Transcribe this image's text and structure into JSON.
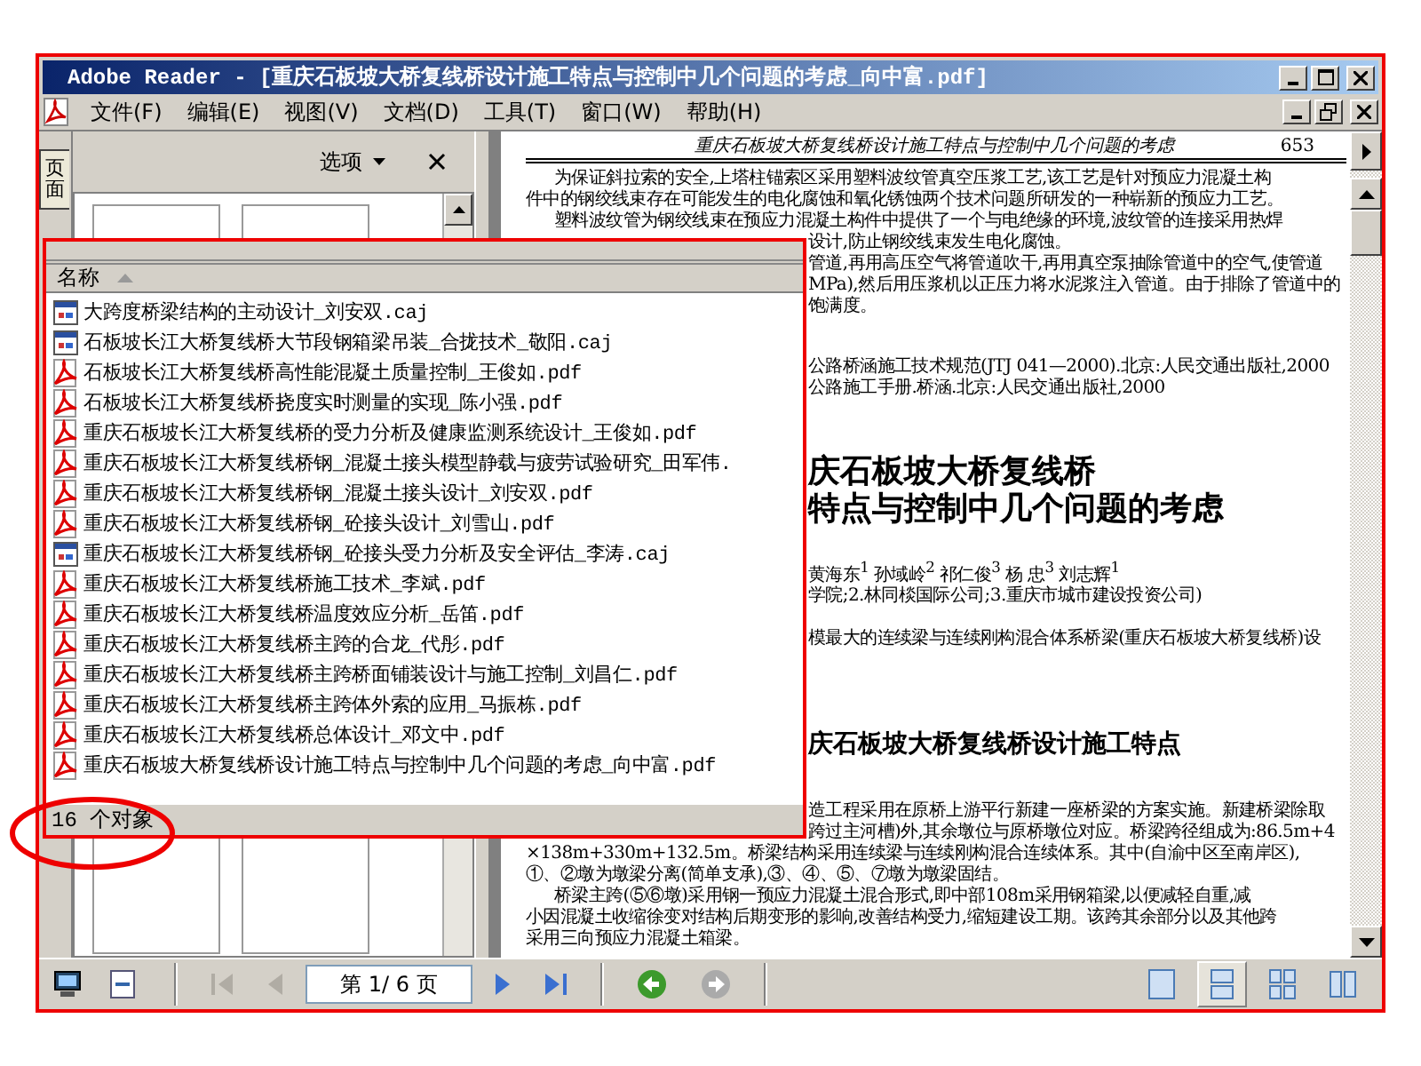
{
  "window": {
    "title": "Adobe Reader - [重庆石板坡大桥复线桥设计施工特点与控制中几个问题的考虑_向中富.pdf]"
  },
  "menu": [
    {
      "label": "文件(F)"
    },
    {
      "label": "编辑(E)"
    },
    {
      "label": "视图(V)"
    },
    {
      "label": "文档(D)"
    },
    {
      "label": "工具(T)"
    },
    {
      "label": "窗口(W)"
    },
    {
      "label": "帮助(H)"
    }
  ],
  "side_panel": {
    "tab": {
      "label": "页面",
      "selected": true
    },
    "options": "选项"
  },
  "document": {
    "running_title": "重庆石板坡大桥复线桥设计施工特点与控制中几个问题的考虑",
    "page_number": "653",
    "sections": [
      {
        "kind": "body",
        "lines": [
          {
            "kind": "indent",
            "text": "为保证斜拉索的安全,上塔柱锚索区采用塑料波纹管真空压浆工艺,该工艺是针对预应力混凝土构"
          },
          {
            "kind": "full",
            "text": "件中的钢绞线束存在可能发生的电化腐蚀和氧化锈蚀两个技术问题所研发的一种崭新的预应力工艺。"
          },
          {
            "kind": "indent",
            "text": "塑料波纹管为钢绞线束在预应力混凝土构件中提供了一个与电绝缘的环境,波纹管的连接采用热焊"
          },
          {
            "kind": "tail",
            "text": "设计,防止钢绞线束发生电化腐蚀。"
          },
          {
            "kind": "tail",
            "text": "管道,再用高压空气将管道吹干,再用真空泵抽除管道中的空气,使管道"
          },
          {
            "kind": "tail",
            "text": "MPa),然后用压浆机以正压力将水泥浆注入管道。由于排除了管道中的"
          },
          {
            "kind": "tail",
            "text": "饱满度。"
          }
        ]
      },
      {
        "kind": "refs",
        "lines": [
          {
            "kind": "tail",
            "text": "公路桥涵施工技术规范(JTJ 041—2000).北京:人民交通出版社,2000"
          },
          {
            "kind": "tail",
            "text": "公路施工手册.桥涵.北京:人民交通出版社,2000"
          }
        ]
      },
      {
        "kind": "title",
        "lines": [
          {
            "kind": "tail",
            "text": "庆石板坡大桥复线桥"
          },
          {
            "kind": "tail",
            "text": "特点与控制中几个问题的考虑"
          }
        ]
      },
      {
        "kind": "authors",
        "lines": [
          {
            "kind": "tail",
            "text": "黄海东$^{1}$  孙域岭$^{2}$  祁仁俊$^{3}$  杨  忠$^{3}$  刘志辉$^{1}$"
          },
          {
            "kind": "tail",
            "text": "学院;2.林同棪国际公司;3.重庆市城市建设投资公司)"
          }
        ]
      },
      {
        "kind": "abstract",
        "lines": [
          {
            "kind": "tail",
            "text": "模最大的连续梁与连续刚构混合体系桥梁(重庆石板坡大桥复线桥)设"
          }
        ]
      },
      {
        "kind": "heading",
        "lines": [
          {
            "kind": "tail",
            "text": "庆石板坡大桥复线桥设计施工特点"
          }
        ]
      },
      {
        "kind": "body2",
        "lines": [
          {
            "kind": "tail",
            "text": "造工程采用在原桥上游平行新建一座桥梁的方案实施。新建桥梁除取"
          },
          {
            "kind": "tail",
            "text": "跨过主河槽)外,其余墩位与原桥墩位对应。桥梁跨径组成为:86.5m+4"
          },
          {
            "kind": "full",
            "text": "×138m+330m+132.5m。桥梁结构采用连续梁与连续刚构混合连续体系。其中(自渝中区至南岸区),"
          },
          {
            "kind": "full",
            "text": "①、②墩为墩梁分离(简单支承),③、④、⑤、⑦墩为墩梁固结。"
          },
          {
            "kind": "indent",
            "text": "桥梁主跨(⑤⑥墩)采用钢一预应力混凝土混合形式,即中部108m采用钢箱梁,以便减轻自重,减"
          },
          {
            "kind": "full",
            "text": "小因混凝土收缩徐变对结构后期变形的影响,改善结构受力,缩短建设工期。该跨其余部分以及其他跨"
          },
          {
            "kind": "full",
            "text": "采用三向预应力混凝土箱梁。"
          }
        ]
      }
    ]
  },
  "file_list": {
    "column": "名称",
    "status": "16 个对象",
    "items": [
      {
        "name": "大跨度桥梁结构的主动设计_刘安双.caj",
        "kind": "window"
      },
      {
        "name": "石板坡长江大桥复线桥大节段钢箱梁吊装_合拢技术_敬阳.caj",
        "kind": "window"
      },
      {
        "name": "石板坡长江大桥复线桥高性能混凝土质量控制_王俊如.pdf",
        "kind": "acrobat"
      },
      {
        "name": "石板坡长江大桥复线桥挠度实时测量的实现_陈小强.pdf",
        "kind": "acrobat"
      },
      {
        "name": "重庆石板坡长江大桥复线桥的受力分析及健康监测系统设计_王俊如.pdf",
        "kind": "acrobat"
      },
      {
        "name": "重庆石板坡长江大桥复线桥钢_混凝土接头模型静载与疲劳试验研究_田军伟.",
        "kind": "acrobat"
      },
      {
        "name": "重庆石板坡长江大桥复线桥钢_混凝土接头设计_刘安双.pdf",
        "kind": "acrobat"
      },
      {
        "name": "重庆石板坡长江大桥复线桥钢_砼接头设计_刘雪山.pdf",
        "kind": "acrobat"
      },
      {
        "name": "重庆石板坡长江大桥复线桥钢_砼接头受力分析及安全评估_李涛.caj",
        "kind": "window"
      },
      {
        "name": "重庆石板坡长江大桥复线桥施工技术_李斌.pdf",
        "kind": "acrobat"
      },
      {
        "name": "重庆石板坡长江大桥复线桥温度效应分析_岳笛.pdf",
        "kind": "acrobat"
      },
      {
        "name": "重庆石板坡长江大桥复线桥主跨的合龙_代彤.pdf",
        "kind": "acrobat"
      },
      {
        "name": "重庆石板坡长江大桥复线桥主跨桥面铺装设计与施工控制_刘昌仁.pdf",
        "kind": "acrobat"
      },
      {
        "name": "重庆石板坡长江大桥复线桥主跨体外索的应用_马振栋.pdf",
        "kind": "acrobat"
      },
      {
        "name": "重庆石板坡长江大桥复线桥总体设计_邓文中.pdf",
        "kind": "acrobat"
      },
      {
        "name": "重庆石板坡大桥复线桥设计施工特点与控制中几个问题的考虑_向中富.pdf",
        "kind": "acrobat"
      }
    ]
  },
  "toolbar": {
    "page_field": "第 1/ 6 页",
    "nav": [
      {
        "kind": "first",
        "disabled": true
      },
      {
        "kind": "prev",
        "disabled": true
      },
      {
        "kind": "next",
        "disabled": false
      },
      {
        "kind": "last",
        "disabled": false
      }
    ],
    "history": [
      {
        "kind": "back",
        "disabled": false
      },
      {
        "kind": "forward",
        "disabled": true
      }
    ],
    "views": [
      {
        "kind": "single",
        "selected": false
      },
      {
        "kind": "continuous",
        "selected": true
      },
      {
        "kind": "grid",
        "selected": false
      },
      {
        "kind": "facing",
        "selected": false
      }
    ]
  }
}
